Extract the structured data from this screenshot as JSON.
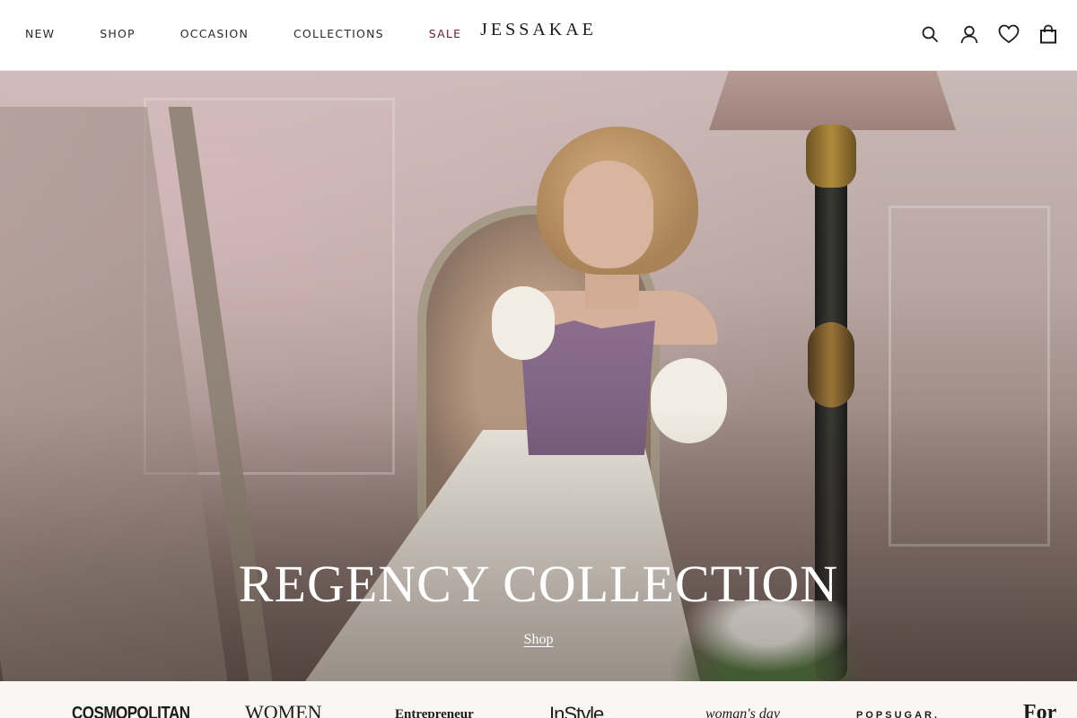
{
  "header": {
    "nav": [
      {
        "label": "NEW"
      },
      {
        "label": "SHOP"
      },
      {
        "label": "OCCASION"
      },
      {
        "label": "COLLECTIONS"
      },
      {
        "label": "SALE"
      }
    ],
    "logo": "JESSAKAE",
    "icons": [
      "search-icon",
      "account-icon",
      "wishlist-heart-icon",
      "shopping-bag-icon"
    ],
    "sale_color": "#6b1e2e"
  },
  "hero": {
    "title": "REGENCY COLLECTION",
    "link_label": "Shop"
  },
  "press": {
    "logos": [
      "COSMOPOLITAN",
      "WOMEN",
      "Entrepreneur",
      "InStyle",
      "woman's day",
      "POPSUGAR.",
      "For"
    ]
  }
}
